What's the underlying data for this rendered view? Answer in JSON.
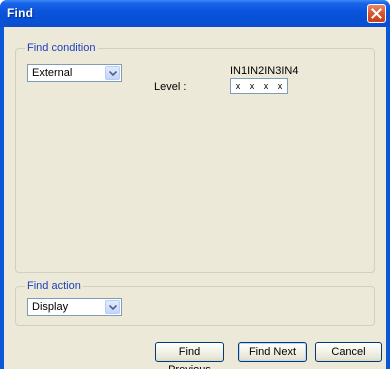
{
  "window": {
    "title": "Find"
  },
  "find_condition": {
    "legend": "Find condition",
    "source_select": {
      "value": "External"
    },
    "level_label": "Level :",
    "inputs_header": "IN1IN2IN3IN4",
    "inputs": [
      "x",
      "x",
      "x",
      "x"
    ]
  },
  "find_action": {
    "legend": "Find action",
    "action_select": {
      "value": "Display"
    }
  },
  "buttons": {
    "find_previous": "Find Previous",
    "find_next": "Find Next",
    "cancel": "Cancel"
  },
  "colors": {
    "titlebar": "#0a55dd",
    "dialog_bg": "#ece9d8",
    "group_legend": "#1e3fbd",
    "close_button": "#d7552f"
  },
  "icons": {
    "close": "close-icon",
    "dropdown": "chevron-down-icon"
  }
}
